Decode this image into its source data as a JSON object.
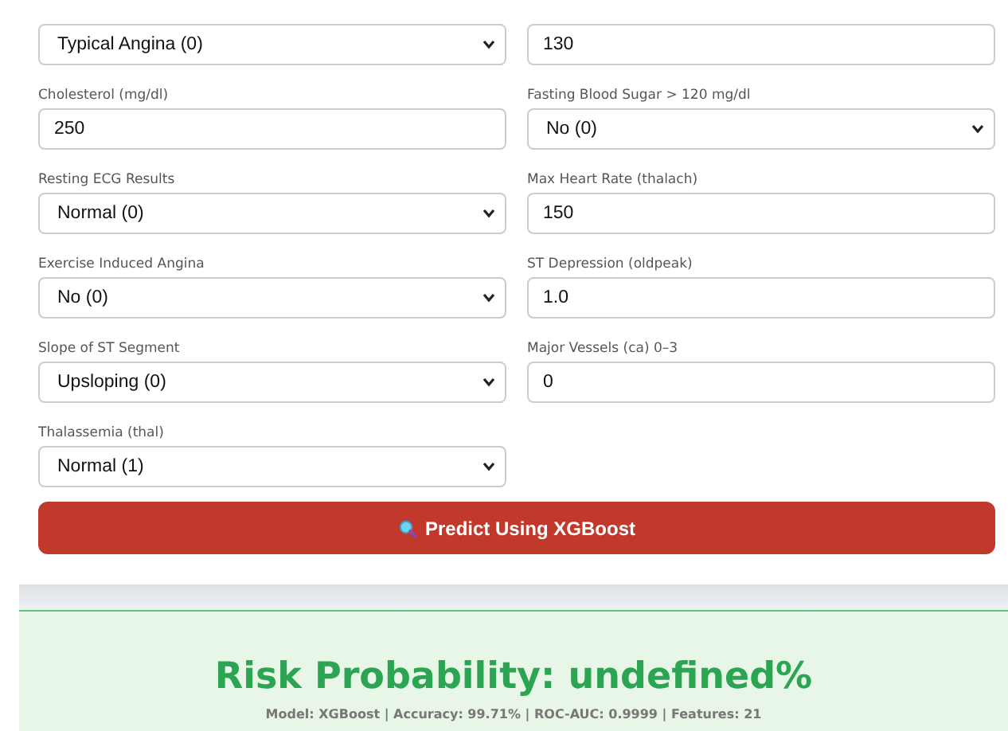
{
  "fields": [
    {
      "kind": "select",
      "value": "Typical Angina (0)"
    },
    {
      "kind": "input",
      "value": "130"
    },
    {
      "kind": "input",
      "label": "Cholesterol (mg/dl)",
      "value": "250"
    },
    {
      "kind": "select",
      "label": "Fasting Blood Sugar > 120 mg/dl",
      "value": "No (0)"
    },
    {
      "kind": "select",
      "label": "Resting ECG Results",
      "value": "Normal (0)"
    },
    {
      "kind": "input",
      "label": "Max Heart Rate (thalach)",
      "value": "150"
    },
    {
      "kind": "select",
      "label": "Exercise Induced Angina",
      "value": "No (0)"
    },
    {
      "kind": "input",
      "label": "ST Depression (oldpeak)",
      "value": "1.0"
    },
    {
      "kind": "select",
      "label": "Slope of ST Segment",
      "value": "Upsloping (0)"
    },
    {
      "kind": "input",
      "label": "Major Vessels (ca) 0–3",
      "value": "0"
    },
    {
      "kind": "select",
      "label": "Thalassemia (thal)",
      "value": "Normal (1)"
    }
  ],
  "predict_button": {
    "label": "Predict Using XGBoost"
  },
  "result": {
    "title": "Risk Probability: undefined%",
    "details": "Model: XGBoost | Accuracy: 99.71% | ROC-AUC: 0.9999 | Features: 21"
  }
}
